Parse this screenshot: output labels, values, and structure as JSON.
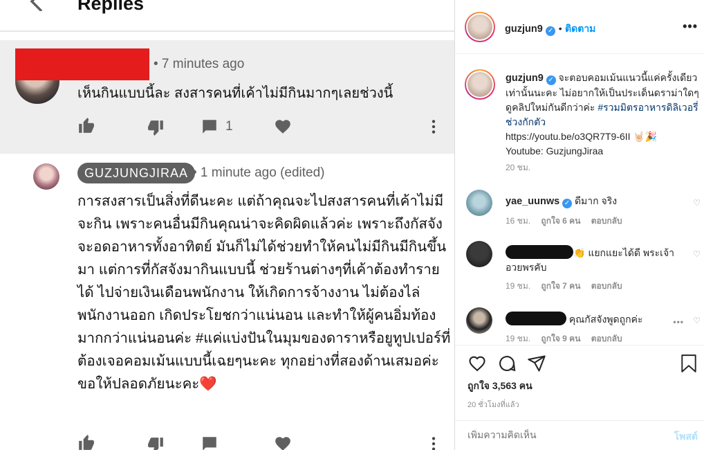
{
  "youtube": {
    "header_title": "Replies",
    "reply1": {
      "meta": "• 7 minutes ago",
      "text": "เห็นกินแบบนี้ละ สงสารคนที่เค้าไม่มีกินมากๆเลยช่วงนี้",
      "comment_count": "1"
    },
    "reply2": {
      "author": "GUZJUNGJIRAA",
      "meta": "• 1 minute ago (edited)",
      "text": "การสงสารเป็นสิ่งที่ดีนะคะ แต่ถ้าคุณจะไปสงสารคนที่เค้าไม่มีจะกิน เพราะคนอื่นมีกินคุณน่าจะคิดผิดแล้วค่ะ เพราะถึงกัสจังจะอดอาหารทั้งอาทิตย์ มันก็ไม่ได้ช่วยทำให้คนไม่มีกินมีกินขึ้นมา แต่การที่กัสจังมากินแบบนี้ ช่วยร้านต่างๆที่เค้าต้องทำรายได้ ไปจ่ายเงินเดือนพนักงาน ให้เกิดการจ้างงาน ไม่ต้องไล่พนักงานออก เกิดประโยชกว่าแน่นอน และทำให้ผู้คนอิ่มท้องมากกว่าแน่นอนค่ะ #แค่แบ่งปันในมุมของดาราหรือยูทูปเปอร์ที่ต้องเจอคอมเม้นแบบนี้เฉยๆนะคะ ทุกอย่างที่สองด้านเสมอค่ะ ขอให้ปลอดภัยนะคะ",
      "emoji": "❤️"
    }
  },
  "instagram": {
    "header": {
      "username": "guzjun9",
      "separator": "•",
      "follow_label": "ติดตาม",
      "more": "•••"
    },
    "caption": {
      "username": "guzjun9",
      "text_before_tag": " จะตอบคอมเม้นแนวนี้แค่ครั้งเดียวเท่านั้นนะคะ ไม่อยากให้เป็นประเด็นดราม่าใดๆ ดูคลิปใหม่กันดีกว่าค่ะ ",
      "hashtag": "#รวมมิตรอาหารดิลิเวอรี่ช่วงกักตัว",
      "link": "https://youtu.be/o3QR7T9-6II",
      "link_emoji": " 🤘🏻🎉",
      "youtube_line": "Youtube: GuzjungJiraa",
      "time": "20 ชม."
    },
    "comments": [
      {
        "username": "yae_uunws",
        "text": "ดีมาก จริง",
        "time": "16 ชม.",
        "likes": "ถูกใจ 6 คน",
        "reply": "ตอบกลับ"
      },
      {
        "text": "👏 แยกแยะได้ดี พระเจ้าอวยพรคับ",
        "time": "19 ชม.",
        "likes": "ถูกใจ 7 คน",
        "reply": "ตอบกลับ"
      },
      {
        "text": "คุณกัสจังพูดถูกค่ะ",
        "time": "19 ชม.",
        "likes": "ถูกใจ 9 คน",
        "reply": "ตอบกลับ"
      }
    ],
    "likes_text": "ถูกใจ 3,563 คน",
    "post_time": "20 ชั่วโมงที่แล้ว",
    "add_comment_placeholder": "เพิ่มความคิดเห็น",
    "post_label": "โพสต์"
  }
}
